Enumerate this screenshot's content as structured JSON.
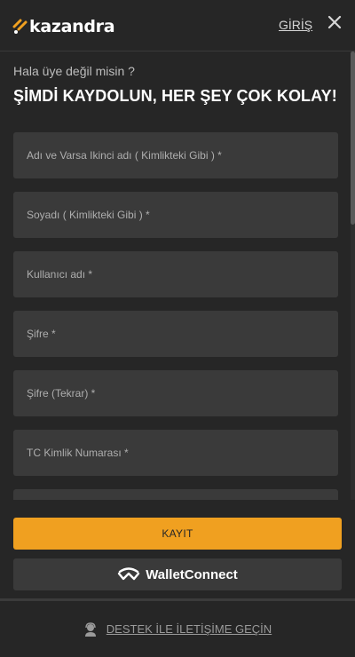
{
  "header": {
    "logo_text": "kazandra",
    "login_label": "GİRİŞ",
    "close_icon": "close-icon"
  },
  "form": {
    "subtitle": "Hala üye değil misin ?",
    "title": "ŞİMDİ KAYDOLUN, HER ŞEY ÇOK KOLAY!",
    "fields": [
      {
        "placeholder": "Adı ve Varsa Ikinci adı ( Kimlikteki Gibi ) *"
      },
      {
        "placeholder": "Soyadı ( Kimlikteki Gibi ) *"
      },
      {
        "placeholder": "Kullanıcı adı *"
      },
      {
        "placeholder": "Şifre *"
      },
      {
        "placeholder": "Şifre (Tekrar) *"
      },
      {
        "placeholder": "TC Kimlik Numarası *"
      },
      {
        "placeholder": ""
      }
    ]
  },
  "footer": {
    "register_label": "KAYIT",
    "walletconnect_label": "WalletConnect",
    "support_label": "DESTEK İLE İLETİŞİME GEÇİN"
  },
  "colors": {
    "background": "#262626",
    "field": "#3a3a3a",
    "accent": "#f0a020"
  }
}
